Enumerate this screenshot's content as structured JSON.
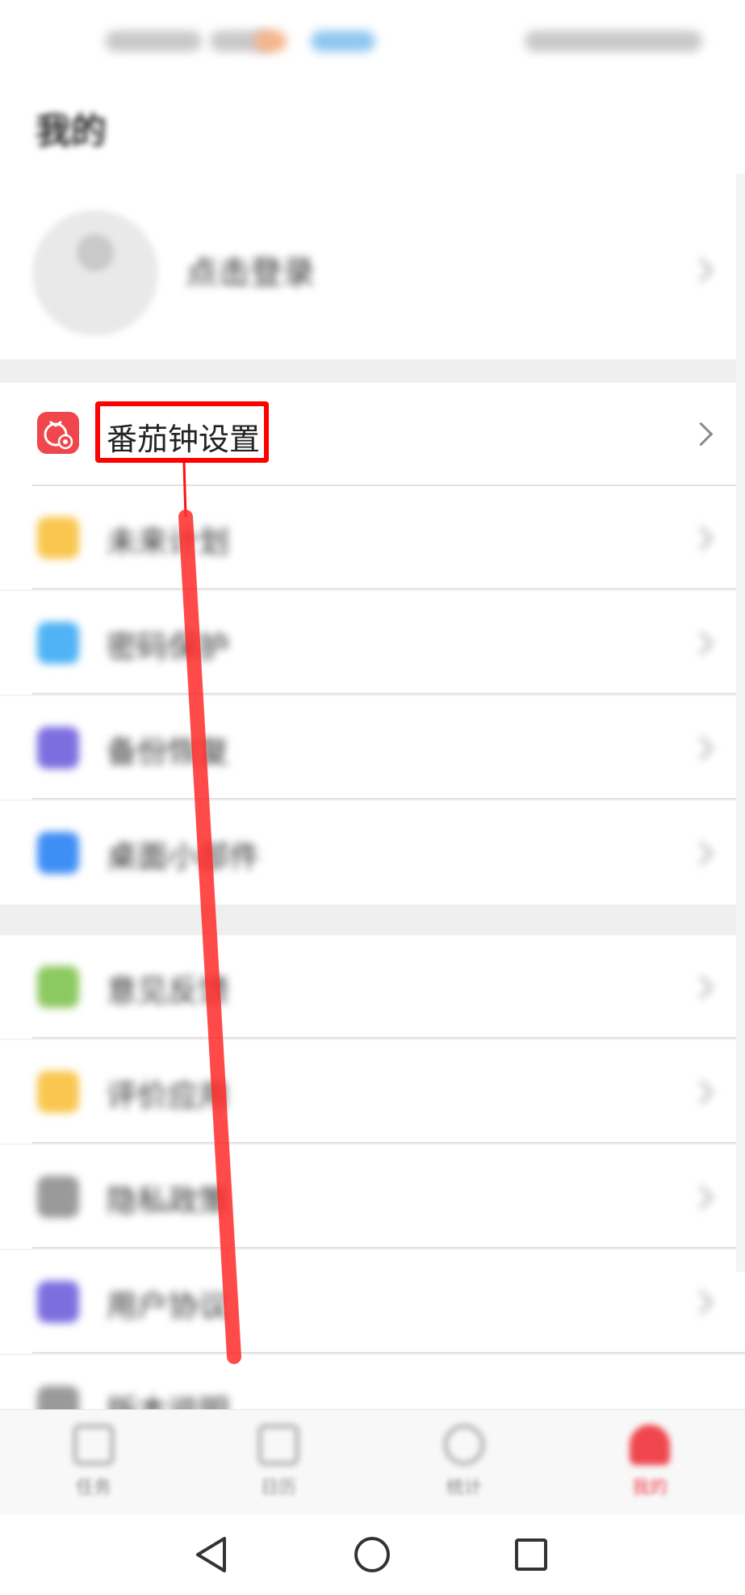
{
  "header": {
    "title": "我的"
  },
  "profile": {
    "login_text": "点击登录"
  },
  "highlight_item": {
    "label": "番茄钟设置",
    "icon": "tomato-gear-icon",
    "color": "#f0464e"
  },
  "menu_groups": [
    {
      "items": [
        {
          "label": "未来计划",
          "icon": "calendar-icon",
          "color": "#f9c74f"
        },
        {
          "label": "密码保护",
          "icon": "lock-icon",
          "color": "#4fb3f5"
        },
        {
          "label": "备份恢复",
          "icon": "backup-icon",
          "color": "#7d6ee0"
        },
        {
          "label": "桌面小部件",
          "icon": "widget-icon",
          "color": "#3f8ef5"
        }
      ]
    },
    {
      "items": [
        {
          "label": "意见反馈",
          "icon": "feedback-icon",
          "color": "#8cc960"
        },
        {
          "label": "评价应用",
          "icon": "star-icon",
          "color": "#f9c74f"
        },
        {
          "label": "隐私政策",
          "icon": "privacy-icon",
          "color": "#9a9a9a"
        },
        {
          "label": "用户协议",
          "icon": "agreement-icon",
          "color": "#7d6ee0"
        },
        {
          "label": "版本说明",
          "icon": "info-icon",
          "color": "#9a9a9a"
        }
      ]
    }
  ],
  "bottom_nav": [
    {
      "label": "任务",
      "icon": "task-icon"
    },
    {
      "label": "日历",
      "icon": "calendar-nav-icon"
    },
    {
      "label": "统计",
      "icon": "stats-icon"
    },
    {
      "label": "我的",
      "icon": "person-icon",
      "active": true,
      "active_color": "#f0464e"
    }
  ],
  "system_nav": {
    "back": "back-icon",
    "home": "home-icon",
    "recent": "recent-apps-icon"
  }
}
